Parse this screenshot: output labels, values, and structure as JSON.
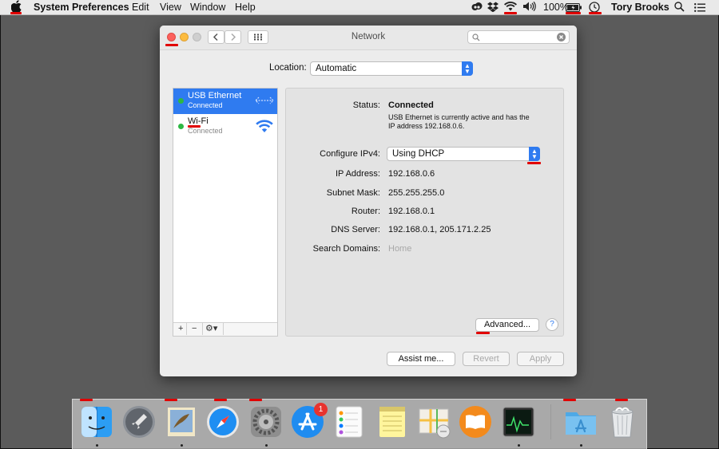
{
  "menubar": {
    "apple_icon": "apple-icon",
    "app_name": "System Preferences",
    "menus": [
      "Edit",
      "View",
      "Window",
      "Help"
    ],
    "status_icons": [
      "creative-cloud-icon",
      "dropbox-icon",
      "wifi-icon",
      "volume-icon"
    ],
    "battery_percent": "100%",
    "user_name": "Tory Brooks",
    "right_icons": [
      "battery-icon",
      "time-machine-icon",
      "spotlight-icon",
      "notification-center-icon"
    ]
  },
  "window": {
    "title": "Network",
    "location_label": "Location:",
    "location_value": "Automatic",
    "search_placeholder": ""
  },
  "services": [
    {
      "name": "USB Ethernet",
      "status": "Connected",
      "selected": true,
      "icon": "ethernet-arrows-icon"
    },
    {
      "name": "Wi-Fi",
      "status": "Connected",
      "selected": false,
      "icon": "wifi-icon"
    }
  ],
  "sidebar_footer": {
    "add": "+",
    "remove": "−",
    "gear": "⚙▾"
  },
  "details": {
    "status_label": "Status:",
    "status_value": "Connected",
    "status_desc_1": "USB Ethernet is currently active and has the",
    "status_desc_2": "IP address 192.168.0.6.",
    "configure_label": "Configure IPv4:",
    "configure_value": "Using DHCP",
    "ip_label": "IP Address:",
    "ip_value": "192.168.0.6",
    "subnet_label": "Subnet Mask:",
    "subnet_value": "255.255.255.0",
    "router_label": "Router:",
    "router_value": "192.168.0.1",
    "dns_label": "DNS Server:",
    "dns_value": "192.168.0.1, 205.171.2.25",
    "search_domains_label": "Search Domains:",
    "search_domains_value": "Home",
    "advanced_label": "Advanced...",
    "help_label": "?"
  },
  "buttons": {
    "assist": "Assist me...",
    "revert": "Revert",
    "apply": "Apply"
  },
  "dock": {
    "apps": [
      "finder-icon",
      "launchpad-icon",
      "mail-icon",
      "safari-icon",
      "system-preferences-icon",
      "app-store-icon",
      "reminders-icon",
      "notes-icon",
      "maps-icon",
      "ibooks-icon",
      "activity-monitor-icon",
      "applications-folder-icon",
      "trash-icon"
    ],
    "app_store_badge": "1"
  },
  "colors": {
    "accent": "#2f7bf0",
    "annotation": "#e10000",
    "status_green": "#2db843"
  }
}
